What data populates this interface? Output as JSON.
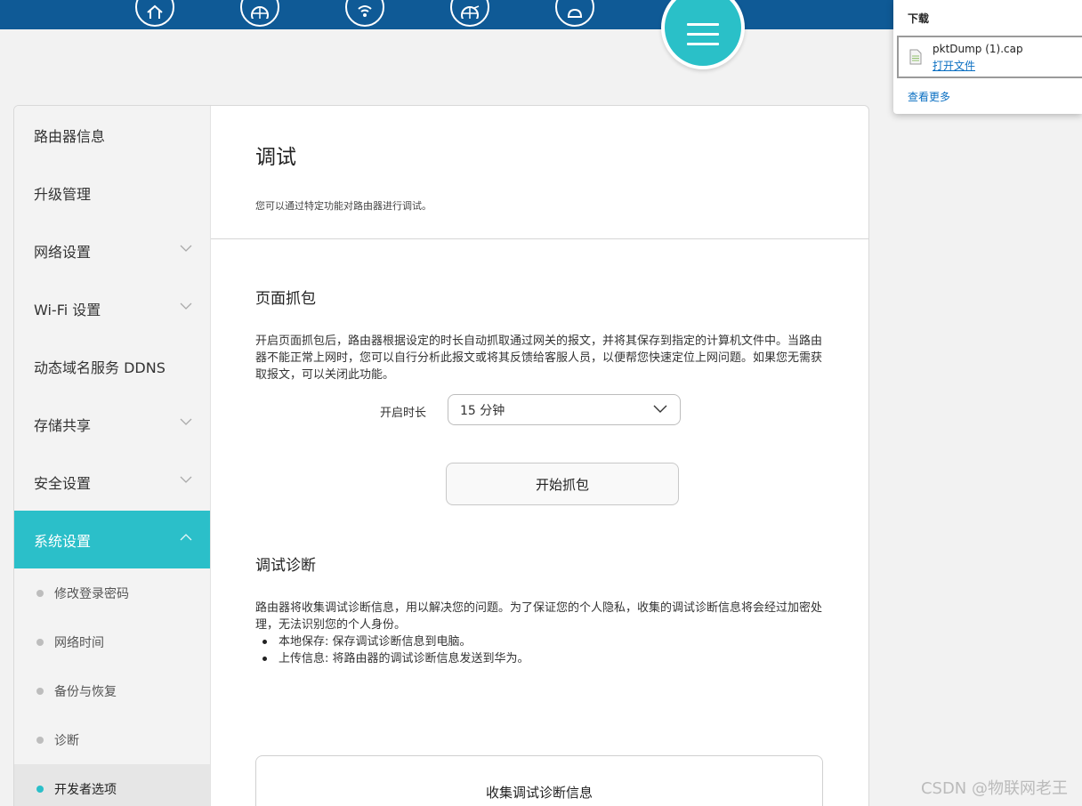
{
  "nav": {
    "icons": [
      "home-icon",
      "globe-icon",
      "wifi-icon",
      "globe-sync-icon",
      "user-icon",
      "menu-icon"
    ],
    "accent": "#2bbfc9",
    "bar_color": "#0f5a96"
  },
  "sidebar": {
    "items": [
      {
        "label": "路由器信息"
      },
      {
        "label": "升级管理"
      },
      {
        "label": "网络设置"
      },
      {
        "label": "Wi-Fi 设置"
      },
      {
        "label": "动态域名服务 DDNS"
      },
      {
        "label": "存储共享"
      },
      {
        "label": "安全设置"
      },
      {
        "label": "系统设置"
      }
    ],
    "sub_items": [
      {
        "label": "修改登录密码"
      },
      {
        "label": "网络时间"
      },
      {
        "label": "备份与恢复"
      },
      {
        "label": "诊断"
      },
      {
        "label": "开发者选项"
      }
    ]
  },
  "main": {
    "title": "调试",
    "description": "您可以通过特定功能对路由器进行调试。",
    "capture": {
      "title": "页面抓包",
      "text": "开启页面抓包后，路由器根据设定的时长自动抓取通过网关的报文，并将其保存到指定的计算机文件中。当路由器不能正常上网时，您可以自行分析此报文或将其反馈给客服人员，以便帮您快速定位上网问题。如果您无需获取报文，可以关闭此功能。",
      "duration_label": "开启时长",
      "duration_value": "15 分钟",
      "start_button": "开始抓包"
    },
    "diagnosis": {
      "title": "调试诊断",
      "text": "路由器将收集调试诊断信息，用以解决您的问题。为了保证您的个人隐私，收集的调试诊断信息将会经过加密处理，无法识别您的个人身份。",
      "bullets": [
        "本地保存: 保存调试诊断信息到电脑。",
        "上传信息: 将路由器的调试诊断信息发送到华为。"
      ],
      "collect_button": "收集调试诊断信息"
    }
  },
  "downloads": {
    "title": "下载",
    "file_name": "pktDump (1).cap",
    "open_link": "打开文件",
    "more_link": "查看更多"
  },
  "watermark": "CSDN @物联网老王"
}
